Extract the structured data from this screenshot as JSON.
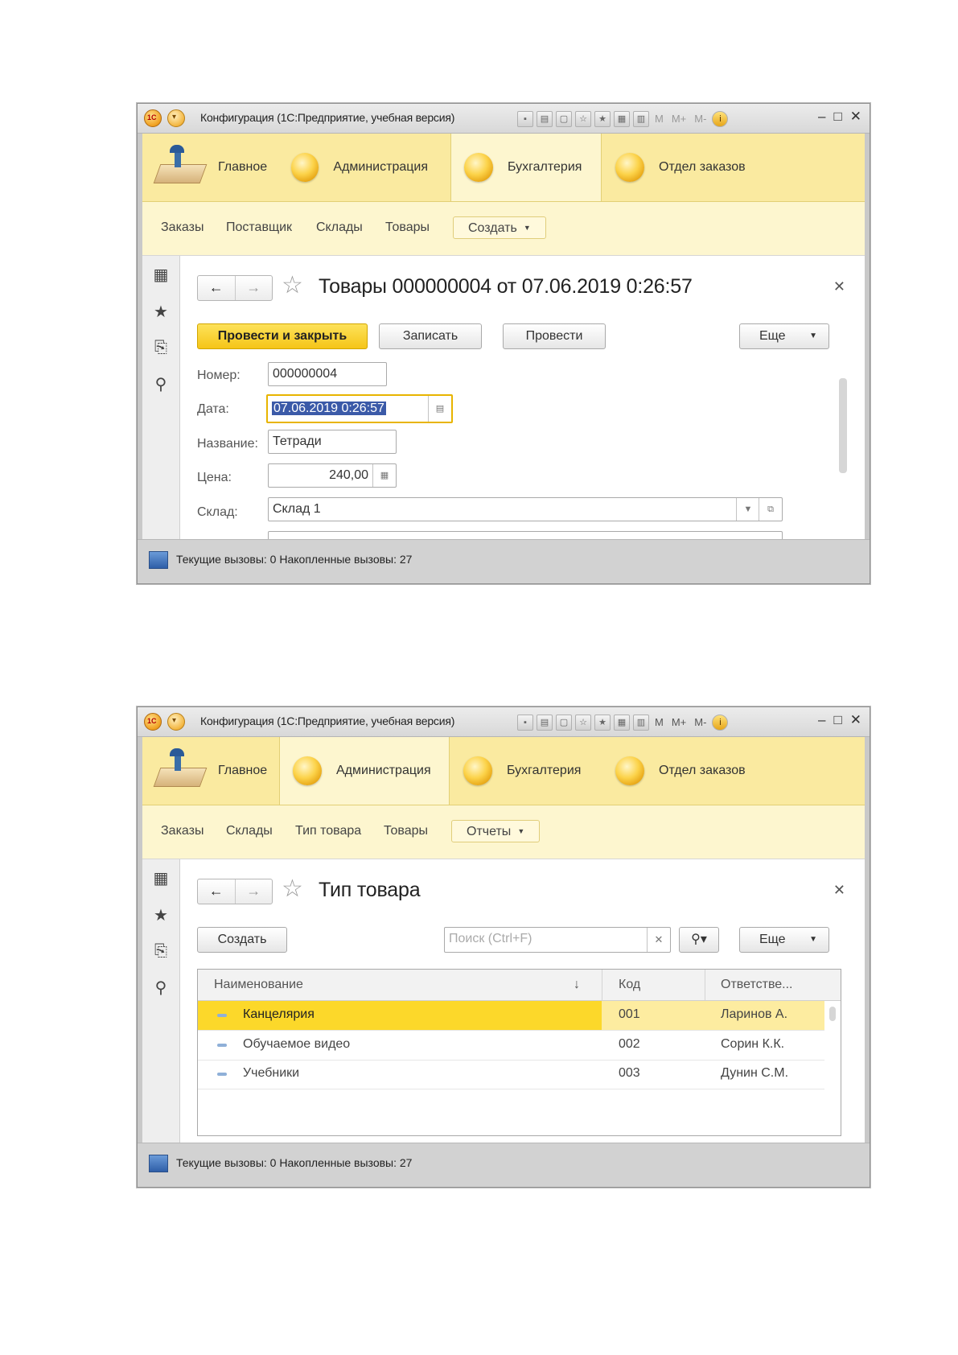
{
  "windows": [
    {
      "title": "Конфигурация  (1С:Предприятие, учебная версия)",
      "toolbar_text": [
        "M",
        "M+",
        "M-"
      ],
      "sections": [
        "Главное",
        "Администрация",
        "Бухгалтерия",
        "Отдел заказов"
      ],
      "active_section": "Бухгалтерия",
      "functions": [
        "Заказы",
        "Поставщик",
        "Склады",
        "Товары"
      ],
      "function_button": "Создать",
      "form": {
        "title": "Товары 000000004 от 07.06.2019 0:26:57",
        "buttons": {
          "post_close": "Провести и закрыть",
          "write": "Записать",
          "post": "Провести",
          "more": "Еще"
        },
        "fields": {
          "number_label": "Номер:",
          "number_value": "000000004",
          "date_label": "Дата:",
          "date_value": "07.06.2019  0:26:57",
          "name_label": "Название:",
          "name_value": "Тетради",
          "price_label": "Цена:",
          "price_value": "240,00",
          "warehouse_label": "Склад:",
          "warehouse_value": "Склад 1"
        }
      },
      "status": "Текущие вызовы: 0   Накопленные вызовы: 27"
    },
    {
      "title": "Конфигурация  (1С:Предприятие, учебная версия)",
      "toolbar_text": [
        "M",
        "M+",
        "M-"
      ],
      "sections": [
        "Главное",
        "Администрация",
        "Бухгалтерия",
        "Отдел заказов"
      ],
      "active_section": "Администрация",
      "functions": [
        "Заказы",
        "Склады",
        "Тип товара",
        "Товары"
      ],
      "function_button": "Отчеты",
      "form": {
        "title": "Тип товара",
        "create_button": "Создать",
        "search_placeholder": "Поиск (Ctrl+F)",
        "more": "Еще",
        "columns": [
          "Наименование",
          "Код",
          "Ответстве..."
        ],
        "sort_indicator": "↓",
        "rows": [
          {
            "name": "Канцелярия",
            "code": "001",
            "resp": "Ларинов А."
          },
          {
            "name": "Обучаемое видео",
            "code": "002",
            "resp": "Сорин К.К."
          },
          {
            "name": "Учебники",
            "code": "003",
            "resp": "Дунин С.М."
          }
        ]
      },
      "status": "Текущие вызовы: 0   Накопленные вызовы: 27"
    }
  ],
  "colors": {
    "section_bg": "#faeaa0",
    "function_bg": "#fdf6cf",
    "primary_button": "#f5c518",
    "selected_row": "#fcd82a"
  }
}
